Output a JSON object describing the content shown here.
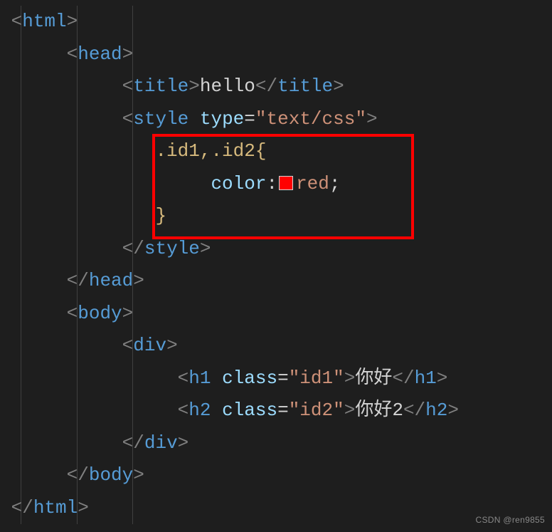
{
  "code": {
    "title_text": "hello",
    "style_attr_name": "type",
    "style_attr_value": "\"text/css\"",
    "css_selector": ".id1,.id2{",
    "css_property": "color",
    "css_value": "red",
    "css_close": "}",
    "h1_class_attr": "class",
    "h1_class_val": "\"id1\"",
    "h1_text": "你好",
    "h2_class_attr": "class",
    "h2_class_val": "\"id2\"",
    "h2_text": "你好2"
  },
  "tags": {
    "html_open": "html",
    "html_close": "html",
    "head_open": "head",
    "head_close": "head",
    "title_open": "title",
    "title_close": "title",
    "style_open": "style",
    "style_close": "style",
    "body_open": "body",
    "body_close": "body",
    "div_open": "div",
    "div_close": "div",
    "h1_open": "h1",
    "h1_close": "h1",
    "h2_open": "h2",
    "h2_close": "h2"
  },
  "colors": {
    "swatch": "#ff0000"
  },
  "watermark": "CSDN @ren9855"
}
